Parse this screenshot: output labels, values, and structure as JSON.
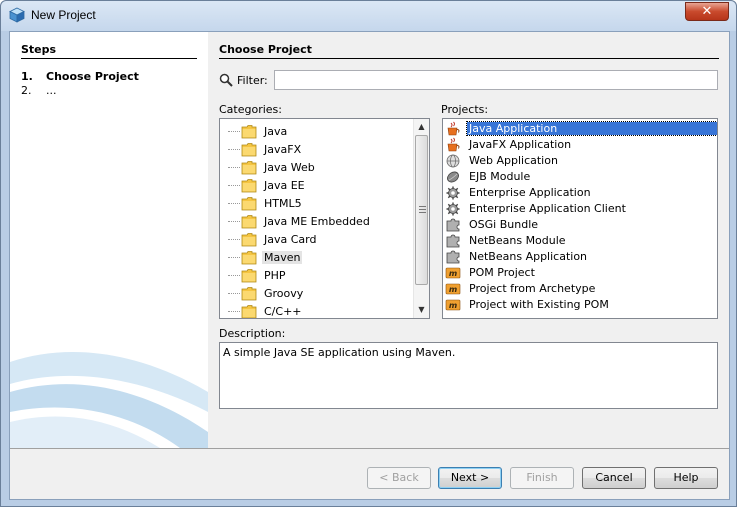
{
  "window": {
    "title": "New Project",
    "close_label": "✕"
  },
  "steps": {
    "title": "Steps",
    "items": [
      {
        "num": "1.",
        "label": "Choose Project"
      },
      {
        "num": "2.",
        "label": "..."
      }
    ]
  },
  "main": {
    "title": "Choose Project",
    "filter_label": "Filter:",
    "filter_value": "",
    "categories_label": "Categories:",
    "projects_label": "Projects:",
    "description_label": "Description:",
    "description_text": "A simple Java SE application using Maven."
  },
  "categories": [
    "Java",
    "JavaFX",
    "Java Web",
    "Java EE",
    "HTML5",
    "Java ME Embedded",
    "Java Card",
    "Maven",
    "PHP",
    "Groovy",
    "C/C++"
  ],
  "selected_category": "Maven",
  "projects": [
    {
      "label": "Java Application",
      "icon": "java-cup-icon"
    },
    {
      "label": "JavaFX Application",
      "icon": "java-cup-icon"
    },
    {
      "label": "Web Application",
      "icon": "globe-icon"
    },
    {
      "label": "EJB Module",
      "icon": "bean-icon"
    },
    {
      "label": "Enterprise Application",
      "icon": "gear-icon"
    },
    {
      "label": "Enterprise Application Client",
      "icon": "gear-icon"
    },
    {
      "label": "OSGi Bundle",
      "icon": "puzzle-icon"
    },
    {
      "label": "NetBeans Module",
      "icon": "puzzle-icon"
    },
    {
      "label": "NetBeans Application",
      "icon": "puzzle-icon"
    },
    {
      "label": "POM Project",
      "icon": "maven-icon"
    },
    {
      "label": "Project from Archetype",
      "icon": "maven-icon"
    },
    {
      "label": "Project with Existing POM",
      "icon": "maven-icon"
    }
  ],
  "selected_project": "Java Application",
  "buttons": {
    "back": "< Back",
    "next": "Next >",
    "finish": "Finish",
    "cancel": "Cancel",
    "help": "Help"
  },
  "colors": {
    "selection": "#3875d7",
    "folder": "#f5c542"
  }
}
